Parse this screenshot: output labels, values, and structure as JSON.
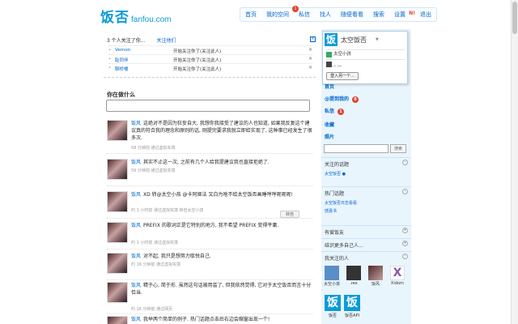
{
  "header": {
    "logo_cn": "饭否",
    "logo_en": "fanfou.com",
    "nav": [
      {
        "label": "首页"
      },
      {
        "label": "我的空间"
      },
      {
        "label": "私信",
        "badge": "1"
      },
      {
        "label": "找人"
      },
      {
        "label": "随便看看"
      },
      {
        "label": "搜索"
      },
      {
        "label": "设置",
        "mark": "N!"
      },
      {
        "label": "退出"
      }
    ]
  },
  "follow_notice": {
    "title": "3 个人关注了你...",
    "link": "关注他们",
    "rows": [
      {
        "who": "Vernon",
        "action": "开始关注你了(关注此人)"
      },
      {
        "who": "耻同伴",
        "action": "开始关注你了(关注此人)"
      },
      {
        "who": "聊桥楼",
        "action": "开始关注你了(关注此人)"
      }
    ]
  },
  "compose": {
    "title": "你在做什么"
  },
  "statuses": [
    {
      "user": "饭风",
      "text": "这绝对不是因为狂妄自大, 我想你我接受了建议的人也知道, 如果我反复这个建议真的符合我的理念和原则的话, 刚提完要求我就立即给实现了, 这种事已经发生了很多次.",
      "meta": "58 分钟前  通过虚拟实境"
    },
    {
      "user": "饭风",
      "text": "其实不止这一次, 之前有几个人给我提建议我也直接拒绝了.",
      "meta": "59 分钟前  通过虚拟实境"
    },
    {
      "user": "饭风",
      "text": "XD 转@太空小孩 @卡阿姬法 又白为啥不给太空饭否画睡哼哼呢呢呢!",
      "meta": "约 1 小时前  通过虚拟实境  转自太空小孩",
      "reply": "转自"
    },
    {
      "user": "饭风",
      "text": "PREFIX 的歌词正是它特别的地方, 我不希望 PREFIX 变得平庸.",
      "meta": "约 1 小时前  通过虚拟实境"
    },
    {
      "user": "饭风",
      "text": "对不起, 我只是想努力取悦自己.",
      "meta": "约 16 分钟前  通过虚拟实境"
    },
    {
      "user": "饭风",
      "text": "精于心, 简于形. 虽然这句话被用滥了, 但我依然觉得, 它对于太空饭否而言十分恰当.",
      "meta": "约 16 分钟前  通过网页"
    },
    {
      "user": "饭风",
      "text": "我举两个简单的例子. 热门话题点击后右边会缩窗出现一个!"
    }
  ],
  "sidebar": {
    "profile": {
      "name": "太空饭否",
      "avatar_char": "饭",
      "accounts": [
        "太空小孩",
        "_ __"
      ],
      "button": "登入另一个..."
    },
    "links": [
      {
        "label": "首页"
      },
      {
        "label": "@提到我的",
        "badge": "8"
      },
      {
        "label": "私信",
        "badge": "1"
      },
      {
        "label": "收藏"
      },
      {
        "label": "照片"
      }
    ],
    "search_button": "搜索",
    "sections": [
      {
        "title": "关注的话题",
        "items": [
          "太空饭否 ●"
        ]
      },
      {
        "title": "热门话题",
        "items": [
          "太空饭否日志看看",
          "感嘉书"
        ]
      },
      {
        "title": "有爱饭友",
        "items": []
      },
      {
        "title": "结识更多自己人...",
        "items": []
      },
      {
        "title": "我关注的人",
        "items": []
      }
    ],
    "friends": [
      {
        "name": "太空小孩",
        "color": "#5a8ec9"
      },
      {
        "name": ".rex",
        "color": "#333333"
      },
      {
        "name": "饭风",
        "color": "#a0707a"
      },
      {
        "name": "Xidorn",
        "color": "#8a5aa8"
      }
    ],
    "fans": [
      {
        "name": "饭否",
        "char": "饭"
      },
      {
        "name": "饭否API",
        "char": "饭"
      }
    ]
  }
}
